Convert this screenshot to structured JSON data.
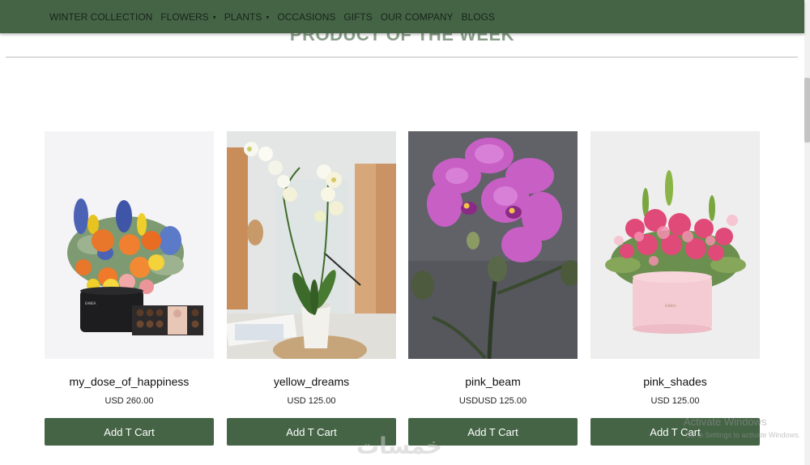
{
  "nav": {
    "items": [
      {
        "label": "WINTER COLLECTION",
        "dropdown": false
      },
      {
        "label": "FLOWERS",
        "dropdown": true
      },
      {
        "label": "PLANTS",
        "dropdown": true
      },
      {
        "label": "OCCASIONS",
        "dropdown": false
      },
      {
        "label": "GIFTS",
        "dropdown": false
      },
      {
        "label": "OUR COMPANY",
        "dropdown": false
      },
      {
        "label": "BLOGS",
        "dropdown": false
      }
    ],
    "caret": "▾"
  },
  "section": {
    "title": "PRODUCT OF THE WEEK"
  },
  "products": [
    {
      "name": "my_dose_of_happiness",
      "price": "USD 260.00",
      "button": "Add T Cart"
    },
    {
      "name": "yellow_dreams",
      "price": "USD 125.00",
      "button": "Add T Cart"
    },
    {
      "name": "pink_beam",
      "price": "USDUSD 125.00",
      "button": "Add T Cart"
    },
    {
      "name": "pink_shades",
      "price": "USD 125.00",
      "button": "Add T Cart"
    }
  ],
  "watermarks": {
    "activate_title": "Activate Windows",
    "activate_sub": "Go to Settings to activate Windows.",
    "site_logo": "خمسات"
  },
  "colors": {
    "nav_bg": "#456446",
    "button_bg": "#456446",
    "title_color": "#8aa08b"
  }
}
